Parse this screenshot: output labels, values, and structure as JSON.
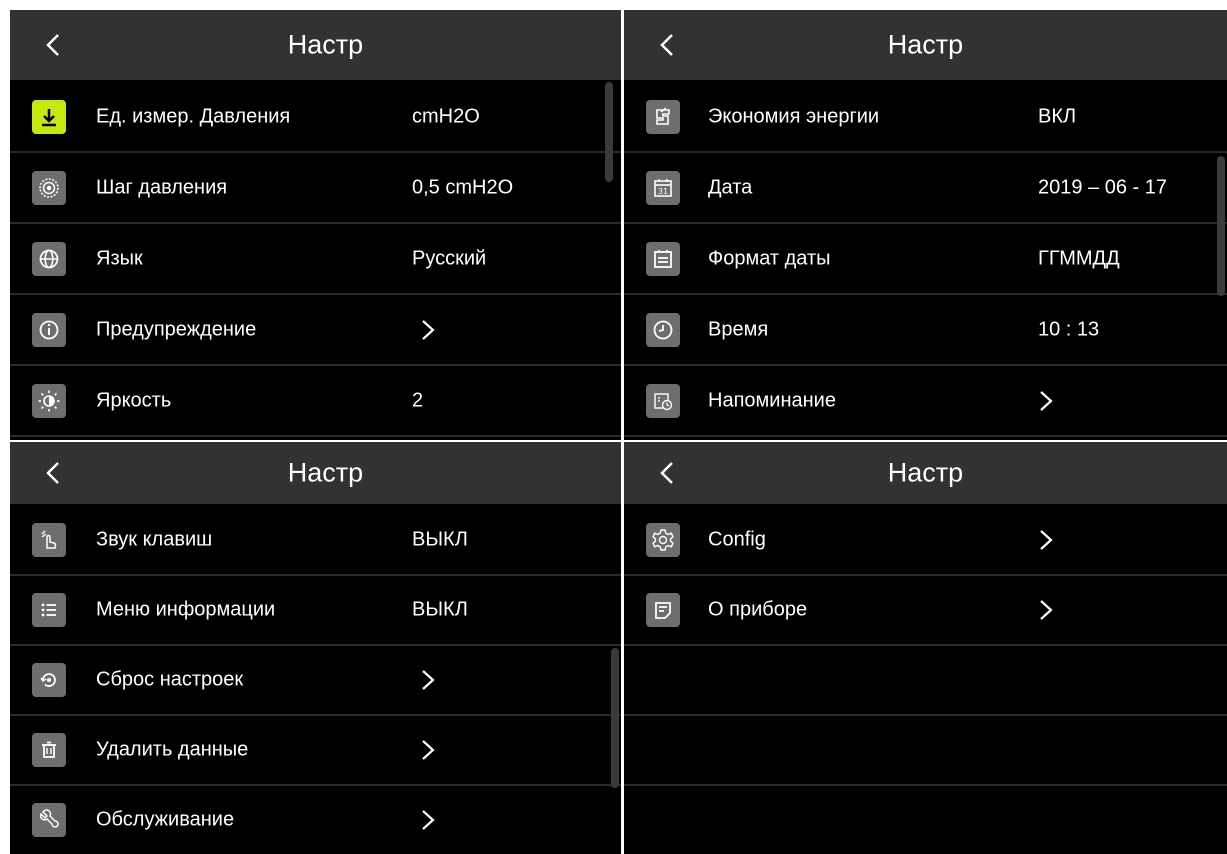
{
  "panels": [
    {
      "title": "Настр",
      "rows": [
        {
          "icon": "download-icon",
          "label": "Ед. измер. Давления",
          "value": "cmH2O"
        },
        {
          "icon": "pressure-target-icon",
          "label": "Шаг давления",
          "value": "0,5 cmH2O"
        },
        {
          "icon": "globe-icon",
          "label": "Язык",
          "value": "Русский"
        },
        {
          "icon": "info-icon",
          "label": "Предупреждение",
          "value": ">"
        },
        {
          "icon": "brightness-icon",
          "label": "Яркость",
          "value": "2"
        }
      ]
    },
    {
      "title": "Настр",
      "rows": [
        {
          "icon": "energy-save-icon",
          "label": "Экономия энергии",
          "value": "ВКЛ"
        },
        {
          "icon": "calendar-31-icon",
          "label": "Дата",
          "value": "2019 – 06 - 17"
        },
        {
          "icon": "calendar-format-icon",
          "label": "Формат даты",
          "value": "ГГММДД"
        },
        {
          "icon": "clock-icon",
          "label": "Время",
          "value": "10 : 13"
        },
        {
          "icon": "reminder-icon",
          "label": "Напоминание",
          "value": ">"
        }
      ]
    },
    {
      "title": "Настр",
      "rows": [
        {
          "icon": "touch-sound-icon",
          "label": "Звук клавиш",
          "value": "ВЫКЛ"
        },
        {
          "icon": "list-icon",
          "label": "Меню информации",
          "value": "ВЫКЛ"
        },
        {
          "icon": "reset-icon",
          "label": "Сброс настроек",
          "value": ">"
        },
        {
          "icon": "trash-icon",
          "label": "Удалить данные",
          "value": ">"
        },
        {
          "icon": "wrench-icon",
          "label": "Обслуживание",
          "value": ">"
        }
      ]
    },
    {
      "title": "Настр",
      "rows": [
        {
          "icon": "gear-icon",
          "label": "Config",
          "value": ">"
        },
        {
          "icon": "document-icon",
          "label": "О приборе",
          "value": ">"
        }
      ]
    }
  ],
  "colors": {
    "background": "#000000",
    "header": "#323232",
    "icon_bg": "#6e6e6e",
    "icon_active": "#c6e80d",
    "text": "#ffffff",
    "divider": "#2a2a2a"
  }
}
